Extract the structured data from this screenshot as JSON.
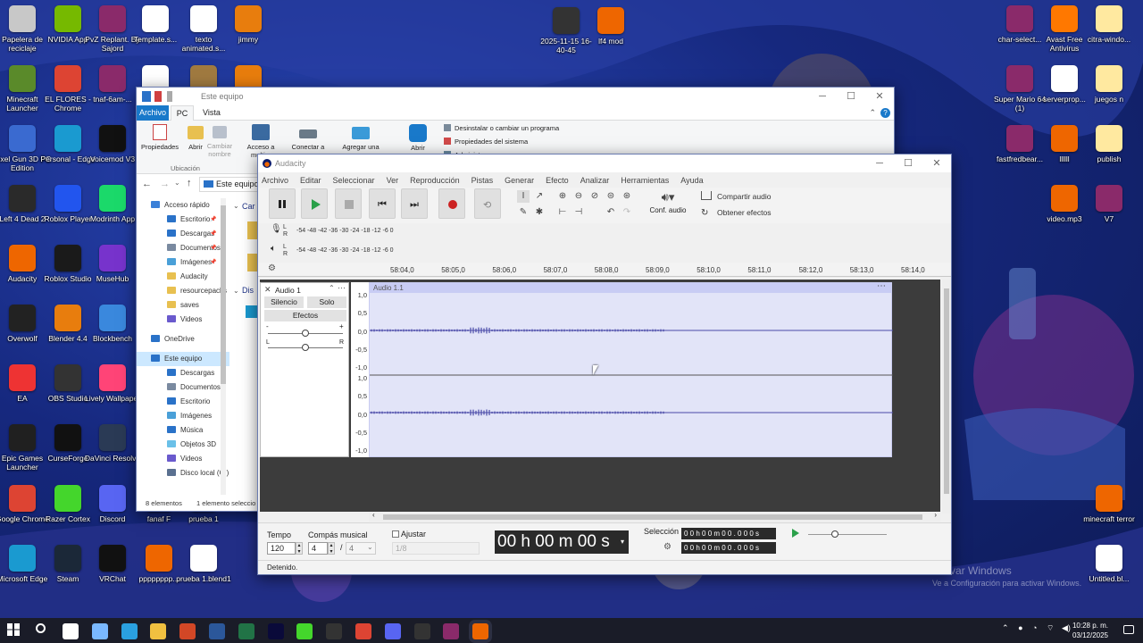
{
  "desktop": {
    "left_icons": [
      {
        "label": "Papelera de reciclaje",
        "c": "#c8c8c8"
      },
      {
        "label": "NVIDIA App",
        "c": "#76b900"
      },
      {
        "label": "PvZ Replant. By Sajord",
        "c": "#8a2a6a"
      },
      {
        "label": "Template.s...",
        "c": "#ffffff"
      },
      {
        "label": "texto animated.s...",
        "c": "#ffffff"
      },
      {
        "label": "jimmy",
        "c": "#e87d0d"
      },
      {
        "label": "Minecraft Launcher",
        "c": "#5a8a2a"
      },
      {
        "label": "EL FLORES - Chrome",
        "c": "#dd4433"
      },
      {
        "label": "tnaf-6am-...",
        "c": "#8a2a6a"
      },
      {
        "label": "",
        "c": "#ffffff"
      },
      {
        "label": "",
        "c": "#a07a40"
      },
      {
        "label": "",
        "c": "#e87d0d"
      },
      {
        "label": "Pixel Gun 3D PC Edition",
        "c": "#3a6ad0"
      },
      {
        "label": "Personal - Edge",
        "c": "#1a9ad0"
      },
      {
        "label": "Voicemod V3",
        "c": "#111111"
      },
      {
        "label": "Left 4 Dead 2",
        "c": "#2a2a2a"
      },
      {
        "label": "Roblox Player",
        "c": "#2255ee"
      },
      {
        "label": "Modrinth App",
        "c": "#1bd96a"
      },
      {
        "label": "Audacity",
        "c": "#ee6600"
      },
      {
        "label": "Roblox Studio",
        "c": "#1a1a1a"
      },
      {
        "label": "MuseHub",
        "c": "#7733cc"
      },
      {
        "label": "Overwolf",
        "c": "#222222"
      },
      {
        "label": "Blender 4.4",
        "c": "#e87d0d"
      },
      {
        "label": "Blockbench",
        "c": "#3a88dd"
      },
      {
        "label": "EA",
        "c": "#ee3333"
      },
      {
        "label": "OBS Studio",
        "c": "#333333"
      },
      {
        "label": "Lively Wallpaper",
        "c": "#ff4477"
      },
      {
        "label": "Epic Games Launcher",
        "c": "#202020"
      },
      {
        "label": "CurseForge",
        "c": "#111111"
      },
      {
        "label": "DaVinci Resolve",
        "c": "#2a3a55"
      },
      {
        "label": "Google Chrome",
        "c": "#dd4433"
      },
      {
        "label": "Razer Cortex",
        "c": "#44d62c"
      },
      {
        "label": "Discord",
        "c": "#5865f2"
      },
      {
        "label": "Microsoft Edge",
        "c": "#1a9ad0"
      },
      {
        "label": "Steam",
        "c": "#1b2838"
      },
      {
        "label": "VRChat",
        "c": "#111111"
      },
      {
        "label": "pppppppp...",
        "c": "#ee6600"
      },
      {
        "label": "prueba 1.blend1",
        "c": "#ffffff"
      },
      {
        "label": "fanaf F",
        "c": "#1b1b1b"
      },
      {
        "label": "prueba 1",
        "c": "#1b1b1b"
      }
    ],
    "top_icons": [
      {
        "label": "2025-11-15 16-40-45",
        "c": "#333333"
      },
      {
        "label": "lf4 mod",
        "c": "#ee6600"
      }
    ],
    "right_icons": [
      {
        "label": "char-select...",
        "c": "#8a2a6a"
      },
      {
        "label": "Avast Free Antivirus",
        "c": "#ff7800"
      },
      {
        "label": "citra-windo...",
        "c": "#ffe9a0"
      },
      {
        "label": "Super Mario 64 (1)",
        "c": "#8a2a6a"
      },
      {
        "label": "serverprop...",
        "c": "#ffffff"
      },
      {
        "label": "juegos n",
        "c": "#ffe9a0"
      },
      {
        "label": "fastfredbear...",
        "c": "#8a2a6a"
      },
      {
        "label": "llllll",
        "c": "#ee6600"
      },
      {
        "label": "publish",
        "c": "#ffe9a0"
      },
      {
        "label": "video.mp3",
        "c": "#ee6600"
      },
      {
        "label": "V7",
        "c": "#8a2a6a"
      },
      {
        "label": "minecraft terror",
        "c": "#ee6600"
      },
      {
        "label": "Untitled.bl...",
        "c": "#ffffff"
      }
    ],
    "watermark": {
      "line1": "Activar Windows",
      "line2": "Ve a Configuración para activar Windows."
    }
  },
  "explorer": {
    "title": "Este equipo",
    "tabs": [
      "Archivo",
      "PC",
      "Vista"
    ],
    "ribbon": {
      "b1": "Propiedades",
      "b2": "Abrir",
      "b3": "Cambiar nombre",
      "b4": "Acceso a multi...",
      "b5": "Conectar a",
      "b6": "Agregar una",
      "b7": "Abrir",
      "group": "Ubicación",
      "r1": "Desinstalar o cambiar un programa",
      "r2": "Propiedades del sistema",
      "r3": "Administrar"
    },
    "address": "Este equipo",
    "content_c": "Car",
    "content_d": "Dis",
    "nav": [
      {
        "label": "Acceso rápido",
        "c": "#3b80d8",
        "pin": ""
      },
      {
        "label": "Escritorio",
        "c": "#2a72c8",
        "pin": "📌"
      },
      {
        "label": "Descargas",
        "c": "#2a72c8",
        "pin": "📌"
      },
      {
        "label": "Documentos",
        "c": "#7a8aa0",
        "pin": "📌"
      },
      {
        "label": "Imágenes",
        "c": "#4aa0d8",
        "pin": "📌"
      },
      {
        "label": "Audacity",
        "c": "#e8c050",
        "pin": ""
      },
      {
        "label": "resourcepacks",
        "c": "#e8c050",
        "pin": ""
      },
      {
        "label": "saves",
        "c": "#e8c050",
        "pin": ""
      },
      {
        "label": "Videos",
        "c": "#6a5acd",
        "pin": ""
      },
      {
        "label": "OneDrive",
        "c": "#2a72c8",
        "pin": ""
      },
      {
        "label": "Este equipo",
        "c": "#2a72c8",
        "pin": ""
      },
      {
        "label": "Descargas",
        "c": "#2a72c8",
        "pin": ""
      },
      {
        "label": "Documentos",
        "c": "#7a8aa0",
        "pin": ""
      },
      {
        "label": "Escritorio",
        "c": "#2a72c8",
        "pin": ""
      },
      {
        "label": "Imágenes",
        "c": "#4aa0d8",
        "pin": ""
      },
      {
        "label": "Música",
        "c": "#2a72c8",
        "pin": ""
      },
      {
        "label": "Objetos 3D",
        "c": "#6ac0e8",
        "pin": ""
      },
      {
        "label": "Videos",
        "c": "#6a5acd",
        "pin": ""
      },
      {
        "label": "Disco local (C:)",
        "c": "#5a7090",
        "pin": ""
      }
    ],
    "status_count": "8 elementos",
    "status_sel": "1 elemento seleccio"
  },
  "audacity": {
    "title": "Audacity",
    "menu": [
      "Archivo",
      "Editar",
      "Seleccionar",
      "Ver",
      "Reproducción",
      "Pistas",
      "Generar",
      "Efecto",
      "Analizar",
      "Herramientas",
      "Ayuda"
    ],
    "audio_setup": "Conf. audio",
    "share_audio": "Compartir audio",
    "get_effects": "Obtener efectos",
    "meter_scale": "-54  -48  -42  -36  -30  -24  -18  -12  -6   0",
    "meter_scale_play": "-54  -48  -42  -36  -30  -24  -18  -12  -6   0",
    "meter_L": "L",
    "meter_R": "R",
    "ruler": [
      "58:04,0",
      "58:05,0",
      "58:06,0",
      "58:07,0",
      "58:08,0",
      "58:09,0",
      "58:10,0",
      "58:11,0",
      "58:12,0",
      "58:13,0",
      "58:14,0"
    ],
    "track": {
      "name": "Audio 1",
      "clip": "Audio 1.1",
      "mute": "Silencio",
      "solo": "Solo",
      "effects": "Efectos",
      "gain_min": "-",
      "gain_max": "+",
      "pan_l": "L",
      "pan_r": "R"
    },
    "y_labels": [
      "1,0",
      "0,5",
      "0,0",
      "-0,5",
      "-1,0"
    ],
    "tempo_label": "Tempo",
    "tempo": "120",
    "timesig_label": "Compás musical",
    "ts_num": "4",
    "ts_sep": "/",
    "ts_den": "4",
    "snap_label": "Ajustar",
    "snap_value": "1/8",
    "time": "00 h 00 m 00 s",
    "selection_label": "Selección",
    "sel_start": "0 0 h 0 0 m 0 0 . 0 0 0 s",
    "sel_end": "0 0 h 0 0 m 0 0 . 0 0 0 s",
    "status": "Detenido."
  },
  "taskbar": {
    "time": "10:28 p. m.",
    "date": "03/12/2025",
    "apps": [
      {
        "name": "task-view",
        "c": "#ffffff"
      },
      {
        "name": "copilot",
        "c": "#7ab8ff"
      },
      {
        "name": "edge",
        "c": "#2aa0e0"
      },
      {
        "name": "explorer",
        "c": "#f0c040"
      },
      {
        "name": "powerpoint",
        "c": "#d24726"
      },
      {
        "name": "word",
        "c": "#2b579a"
      },
      {
        "name": "excel",
        "c": "#217346"
      },
      {
        "name": "animate",
        "c": "#0a0a3a"
      },
      {
        "name": "razer",
        "c": "#44d62c"
      },
      {
        "name": "cursor",
        "c": "#333333"
      },
      {
        "name": "chrome",
        "c": "#dd4433"
      },
      {
        "name": "discord",
        "c": "#5865f2"
      },
      {
        "name": "obs",
        "c": "#333333"
      },
      {
        "name": "winrar",
        "c": "#8a2a6a"
      },
      {
        "name": "audacity",
        "c": "#ee6600"
      }
    ]
  }
}
